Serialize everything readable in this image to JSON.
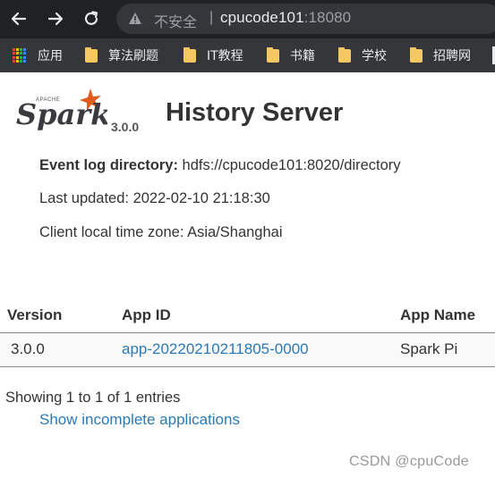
{
  "browser": {
    "security_label": "不安全",
    "separator": "|",
    "url_host": "cpucode101",
    "url_port": ":18080",
    "bookmarks": [
      {
        "label": "应用"
      },
      {
        "label": "算法刷题"
      },
      {
        "label": "IT教程"
      },
      {
        "label": "书籍"
      },
      {
        "label": "学校"
      },
      {
        "label": "招聘网"
      }
    ],
    "apps_grid_colors": [
      "#ea4335",
      "#fbbc05",
      "#34a853",
      "#4285f4"
    ]
  },
  "header": {
    "version": "3.0.0",
    "title": "History Server"
  },
  "info": {
    "event_log_label": "Event log directory:",
    "event_log_value": "hdfs://cpucode101:8020/directory",
    "last_updated": "Last updated: 2022-02-10 21:18:30",
    "timezone": "Client local time zone: Asia/Shanghai"
  },
  "table": {
    "headers": [
      "Version",
      "App ID",
      "App Name"
    ],
    "rows": [
      {
        "version": "3.0.0",
        "app_id": "app-20220210211805-0000",
        "app_name": "Spark Pi"
      }
    ]
  },
  "footer": {
    "showing": "Showing 1 to 1 of 1 entries",
    "incomplete_link": "Show incomplete applications",
    "watermark": "CSDN @cpuCode"
  },
  "colors": {
    "link": "#2a7ab5",
    "spark_orange": "#e25a1c",
    "chrome_dark": "#202124"
  }
}
